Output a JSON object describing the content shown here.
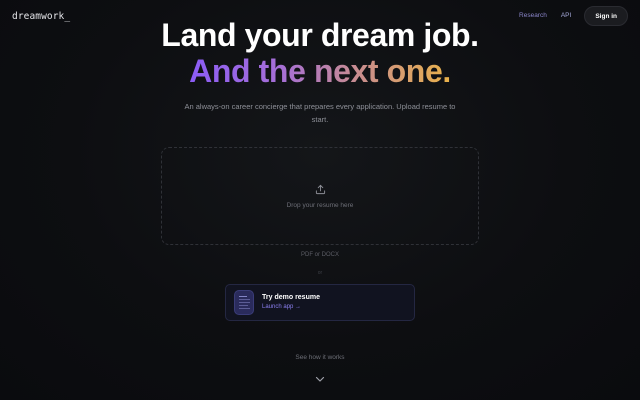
{
  "header": {
    "logo": "dreamwork_",
    "nav": [
      {
        "label": "Research"
      },
      {
        "label": "API"
      }
    ],
    "signin_label": "Sign in"
  },
  "hero": {
    "title": "Land your dream job.",
    "subtitle": "And the next one.",
    "description": "An always-on career concierge that prepares every application. Upload resume to start."
  },
  "upload": {
    "dropzone_label": "Drop your resume here",
    "formats": "PDF or DOCX",
    "or_label": "or",
    "icon": "upload-icon"
  },
  "demo": {
    "title": "Try demo resume",
    "link": "Launch app →",
    "icon": "document-icon"
  },
  "footer": {
    "how_label": "See how it works",
    "icon": "chevron-down-icon"
  },
  "colors": {
    "background": "#0d0e11",
    "accent_purple": "#8b5cf6",
    "accent_gold": "#e9b24a",
    "link": "#8b7ff0"
  }
}
